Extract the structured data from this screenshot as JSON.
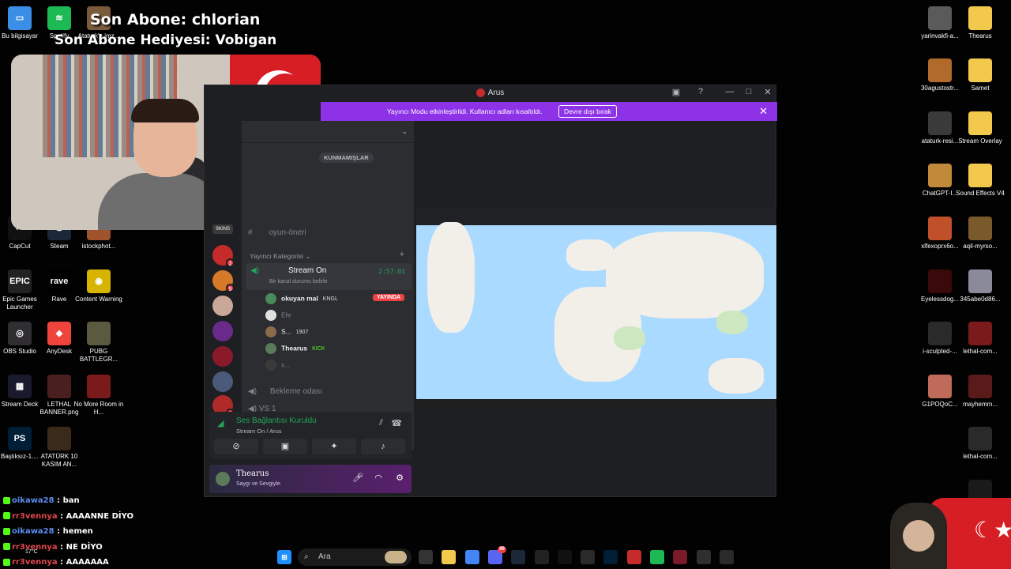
{
  "overlay": {
    "last_sub": "Son Abone: chlorian",
    "last_gift": "Son Abone Hediyesi: Vobigan"
  },
  "desktop_left": [
    {
      "label": "Bu bilgisayar",
      "color": "#3a8ee6",
      "glyph": "▭"
    },
    {
      "label": "Spotify",
      "color": "#1db954",
      "glyph": "≋"
    },
    {
      "label": "Ataturk'e imz...",
      "color": "#7a5b3b",
      "glyph": ""
    },
    {
      "label": "CapCut",
      "color": "#111111",
      "glyph": "✂"
    },
    {
      "label": "Steam",
      "color": "#1b2838",
      "glyph": "♨"
    },
    {
      "label": "istockphot...",
      "color": "#a0522d",
      "glyph": ""
    },
    {
      "label": "Epic Games Launcher",
      "color": "#222222",
      "glyph": "EPIC"
    },
    {
      "label": "Rave",
      "color": "#000000",
      "glyph": "rave"
    },
    {
      "label": "Content Warning",
      "color": "#d6b400",
      "glyph": "◉"
    },
    {
      "label": "OBS Studio",
      "color": "#302e31",
      "glyph": "◎"
    },
    {
      "label": "AnyDesk",
      "color": "#ef443b",
      "glyph": "◆"
    },
    {
      "label": "PUBG BATTLEGR...",
      "color": "#5a5a40",
      "glyph": ""
    },
    {
      "label": "Stream Deck",
      "color": "#1a1a2e",
      "glyph": "▦"
    },
    {
      "label": "LETHAL BANNER.png",
      "color": "#4a1f1f",
      "glyph": ""
    },
    {
      "label": "No More Room in H...",
      "color": "#7a1a1a",
      "glyph": ""
    },
    {
      "label": "Başlıksız-1....",
      "color": "#001e36",
      "glyph": "PS"
    },
    {
      "label": "ATATÜRK 10 KASIM AN...",
      "color": "#3a2a1a",
      "glyph": ""
    }
  ],
  "desktop_right": [
    {
      "label": "yarinvakfi-a...",
      "color": "#5a5a5a",
      "glyph": ""
    },
    {
      "label": "Thearus",
      "color": "#f2c94c",
      "glyph": ""
    },
    {
      "label": "30agustostr...",
      "color": "#b06a2a",
      "glyph": ""
    },
    {
      "label": "Samet",
      "color": "#f2c94c",
      "glyph": ""
    },
    {
      "label": "ataturk-resi...",
      "color": "#3a3a3a",
      "glyph": ""
    },
    {
      "label": "Stream Overlay",
      "color": "#f2c94c",
      "glyph": ""
    },
    {
      "label": "ChatGPT-I...",
      "color": "#c08a3a",
      "glyph": ""
    },
    {
      "label": "Sound Effects V4",
      "color": "#f2c94c",
      "glyph": ""
    },
    {
      "label": "xlfexoprx6o...",
      "color": "#c0502a",
      "glyph": ""
    },
    {
      "label": "aqil-myrso...",
      "color": "#7a5a2a",
      "glyph": ""
    },
    {
      "label": "Eyelessdog...",
      "color": "#3a0a0a",
      "glyph": ""
    },
    {
      "label": "345abe0d86...",
      "color": "#8a8a9a",
      "glyph": ""
    },
    {
      "label": "i-sculpted-...",
      "color": "#2a2a2a",
      "glyph": ""
    },
    {
      "label": "lethal-com...",
      "color": "#7a1a1a",
      "glyph": ""
    },
    {
      "label": "G1POQoC...",
      "color": "#c06a5a",
      "glyph": ""
    },
    {
      "label": "mayhemm...",
      "color": "#5a1a1a",
      "glyph": ""
    },
    {
      "label": "lethal-com...",
      "color": "#2a2a2a",
      "glyph": ""
    },
    {
      "label": "lethal-com...",
      "color": "#1a1a1a",
      "glyph": ""
    }
  ],
  "chat": [
    {
      "user": "oikawa28",
      "color": "#5b8def",
      "msg": "ban"
    },
    {
      "user": "rr3vennya",
      "color": "#e0474c",
      "msg": "AAAANNE DİYO"
    },
    {
      "user": "oikawa28",
      "color": "#5b8def",
      "msg": "hemen"
    },
    {
      "user": "rr3vennya",
      "color": "#e0474c",
      "msg": "NE DİYO"
    },
    {
      "user": "rr3vennya",
      "color": "#e0474c",
      "msg": "AAAAAAA"
    }
  ],
  "weather": {
    "temp": "17°C"
  },
  "discord": {
    "title": "Arus",
    "banner_text": "Yayıncı Modu etkinleştirildi. Kullanıcı adları kısaltıldı.",
    "banner_button": "Devre dışı bırak",
    "unread_tag": "KUNMAMIŞLAR",
    "channel_game_idea": "oyun-öneri",
    "category": "Yayıncı Kategorisi",
    "active_channel": "Stream On",
    "active_timer": "2:57:01",
    "channel_status_placeholder": "Bir kanal durumu belirle",
    "voice_users": [
      {
        "name": "okuyan mal",
        "tag": "KNGL",
        "live": "YAYINDA",
        "color": "#4a8a5a"
      },
      {
        "name": "Efe",
        "tag": "",
        "live": "",
        "color": "#e0e0e0"
      },
      {
        "name": "S...",
        "tag": "1907",
        "live": "",
        "color": "#8a6a4a"
      },
      {
        "name": "Thearus",
        "tag": "KICK",
        "live": "",
        "color": "#5a7a5a"
      },
      {
        "name": "x...",
        "tag": "",
        "live": "",
        "color": "#3a3a3a"
      }
    ],
    "waiting_room": "Bekleme odası",
    "vs_channel": "VS 1",
    "guild_label_skins": "SKINS",
    "guild_badges": [
      "2",
      "5",
      "1"
    ],
    "connection_title": "Ses Bağlantısı Kuruldu",
    "connection_sub": "Stream On / Arus",
    "user_name": "Thearus",
    "user_status": "Saygı ve Sevgiyle."
  },
  "taskbar": {
    "search_placeholder": "Ara",
    "apps": [
      "windows-start",
      "search",
      "widgets",
      "task-view",
      "file-explorer",
      "chrome",
      "discord",
      "steam",
      "capcut",
      "spotify-alt",
      "epic",
      "photoshop",
      "red-app",
      "spotify",
      "capcut-2",
      "obs",
      "epic-2"
    ],
    "discord_badge": "99"
  }
}
